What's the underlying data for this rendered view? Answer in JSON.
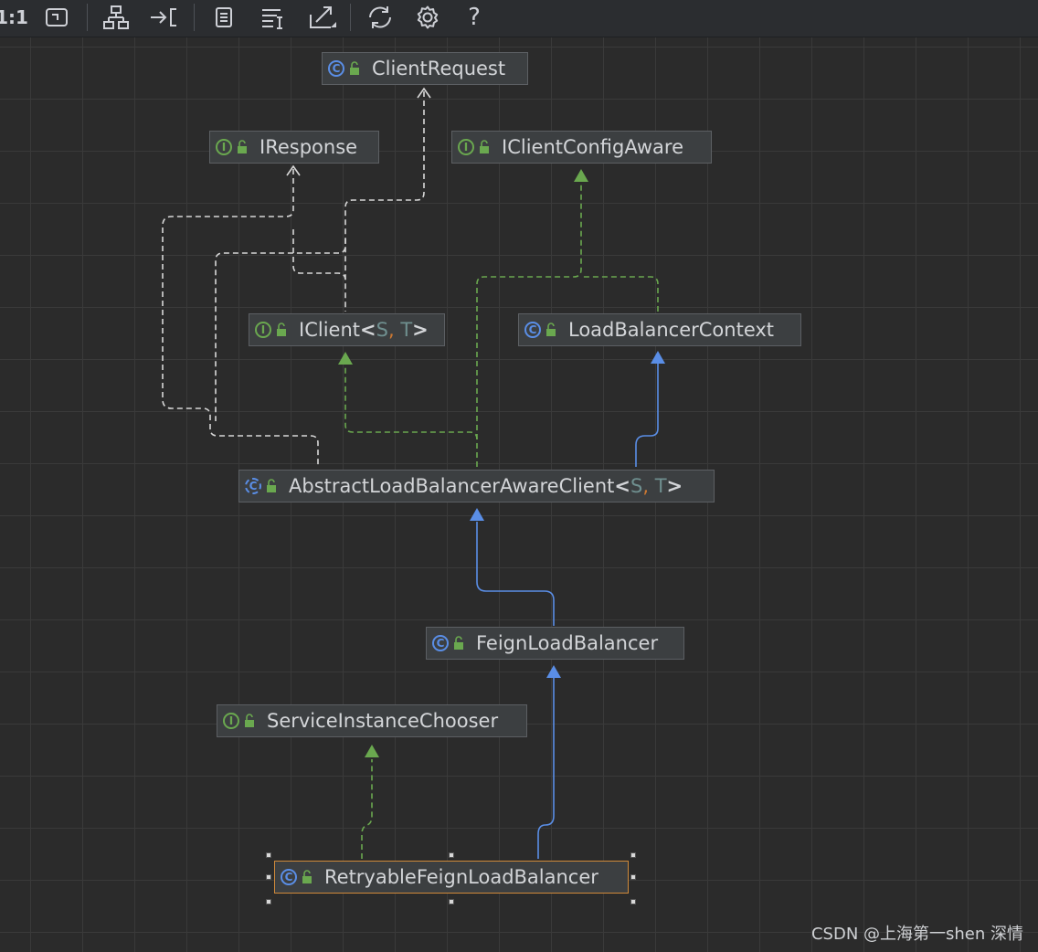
{
  "toolbar": {
    "zoom_label": "1:1",
    "help_label": "?"
  },
  "nodes": {
    "client_request": {
      "name": "ClientRequest",
      "kind": "C"
    },
    "iresponse": {
      "name": "IResponse",
      "kind": "I"
    },
    "iclient_config_aware": {
      "name": "IClientConfigAware",
      "kind": "I"
    },
    "iclient": {
      "name": "IClient",
      "kind": "I",
      "open": "<",
      "p1": "S",
      "sep": ",",
      "p2": "T",
      "close": ">"
    },
    "load_balancer_context": {
      "name": "LoadBalancerContext",
      "kind": "C"
    },
    "abstract_lb_client": {
      "name": "AbstractLoadBalancerAwareClient",
      "kind": "C",
      "open": "<",
      "p1": "S",
      "sep": ",",
      "p2": "T",
      "close": ">"
    },
    "feign_lb": {
      "name": "FeignLoadBalancer",
      "kind": "C"
    },
    "service_instance_chooser": {
      "name": "ServiceInstanceChooser",
      "kind": "I"
    },
    "retryable_feign_lb": {
      "name": "RetryableFeignLoadBalancer",
      "kind": "C"
    }
  },
  "colors": {
    "extends": "#5a8ee6",
    "implements": "#6aa84f",
    "uses": "#d8d8d8",
    "selected": "#d08a3a"
  },
  "watermark": "CSDN @上海第一shen 深情"
}
